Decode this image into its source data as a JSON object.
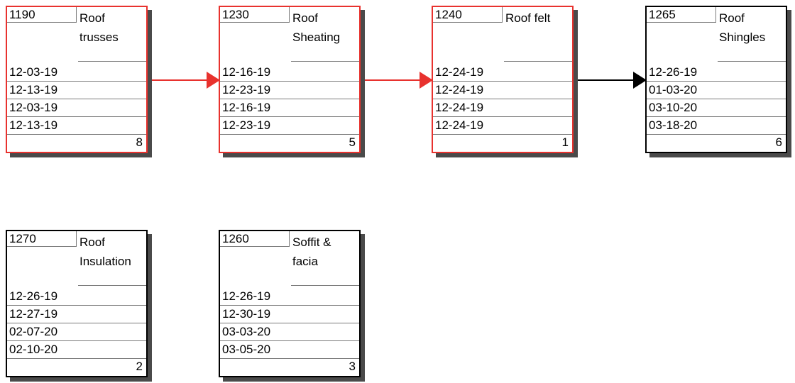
{
  "colors": {
    "critical": "#e8322e",
    "normal": "#000000",
    "shadow": "#4a4a4a"
  },
  "nodes": [
    {
      "id": "1190",
      "name_line1": "Roof",
      "name_line2": "trusses",
      "dates": [
        "12-03-19",
        "12-13-19",
        "12-03-19",
        "12-13-19"
      ],
      "count": "8",
      "critical": true
    },
    {
      "id": "1230",
      "name_line1": "Roof",
      "name_line2": "Sheating",
      "dates": [
        "12-16-19",
        "12-23-19",
        "12-16-19",
        "12-23-19"
      ],
      "count": "5",
      "critical": true
    },
    {
      "id": "1240",
      "name_line1": "Roof felt",
      "name_line2": "",
      "dates": [
        "12-24-19",
        "12-24-19",
        "12-24-19",
        "12-24-19"
      ],
      "count": "1",
      "critical": true
    },
    {
      "id": "1265",
      "name_line1": "Roof",
      "name_line2": "Shingles",
      "dates": [
        "12-26-19",
        "01-03-20",
        "03-10-20",
        "03-18-20"
      ],
      "count": "6",
      "critical": false
    },
    {
      "id": "1270",
      "name_line1": "Roof",
      "name_line2": "Insulation",
      "dates": [
        "12-26-19",
        "12-27-19",
        "02-07-20",
        "02-10-20"
      ],
      "count": "2",
      "critical": false
    },
    {
      "id": "1260",
      "name_line1": "Soffit &",
      "name_line2": "facia",
      "dates": [
        "12-26-19",
        "12-30-19",
        "03-03-20",
        "03-05-20"
      ],
      "count": "3",
      "critical": false
    }
  ],
  "links": [
    {
      "from": "1190",
      "to": "1230",
      "critical": true
    },
    {
      "from": "1230",
      "to": "1240",
      "critical": true
    },
    {
      "from": "1240",
      "to": "1265",
      "critical": false
    }
  ]
}
